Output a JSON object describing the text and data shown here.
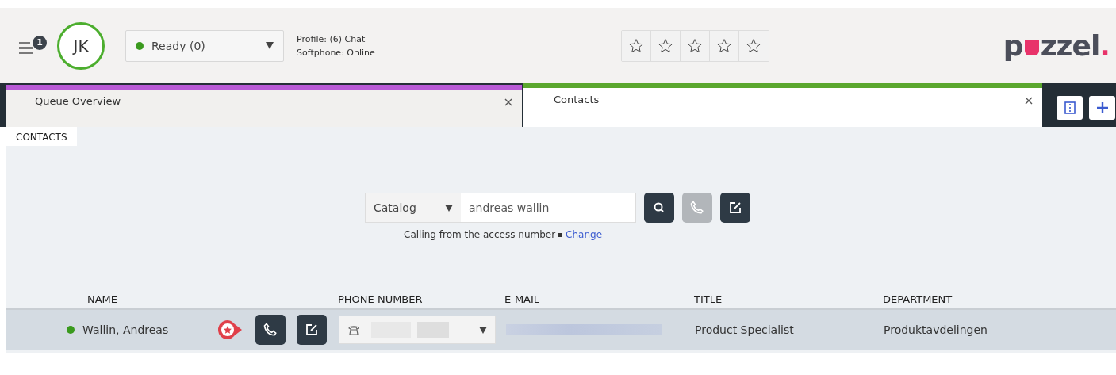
{
  "header": {
    "notifications": "1",
    "avatar": "JK",
    "status": {
      "label": "Ready (0)",
      "color": "#3a9a1e"
    },
    "profile": "Profile: (6) Chat",
    "softphone": "Softphone: Online",
    "favorite_slots": [
      {
        "filled": false
      },
      {
        "filled": false
      },
      {
        "filled": false
      },
      {
        "filled": false
      },
      {
        "filled": false
      }
    ],
    "logo": {
      "before": "p",
      "after": "zzel",
      "dot": "."
    }
  },
  "tabs": [
    {
      "label": "Queue Overview",
      "selected": false,
      "color": "#b85ad6"
    },
    {
      "label": "Contacts",
      "selected": true,
      "color": "#5aa72e"
    }
  ],
  "section": "CONTACTS",
  "search": {
    "source": "Catalog",
    "value": "andreas wallin",
    "call_enabled": false,
    "note": "Calling from the access number",
    "link": "Change"
  },
  "table": {
    "columns": [
      "NAME",
      "PHONE NUMBER",
      "E-MAIL",
      "TITLE",
      "DEPARTMENT"
    ],
    "rows": [
      {
        "name": "Wallin, Andreas",
        "color": "#3a9a1e",
        "favorite": true,
        "title": "Product Specialist",
        "department": "Produktavdelingen"
      }
    ]
  }
}
